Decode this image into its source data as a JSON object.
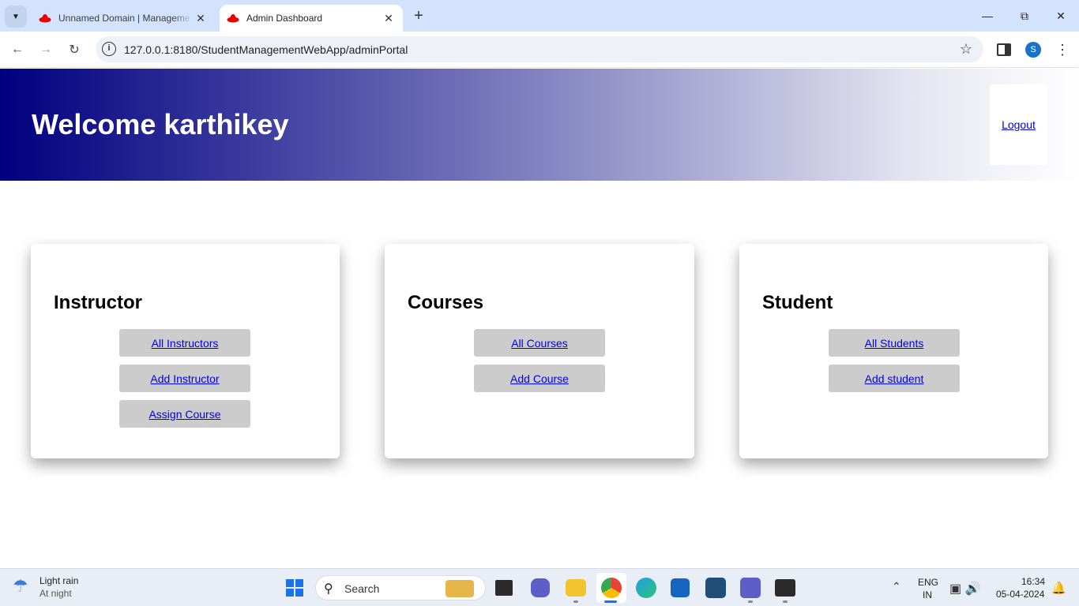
{
  "browser": {
    "tabs": [
      {
        "title": "Unnamed Domain | Manageme",
        "active": false
      },
      {
        "title": "Admin Dashboard",
        "active": true
      }
    ],
    "url": "127.0.0.1:8180/StudentManagementWebApp/adminPortal",
    "profile_initial": "S"
  },
  "header": {
    "welcome": "Welcome karthikey",
    "logout_label": "Logout"
  },
  "cards": [
    {
      "title": "Instructor",
      "links": [
        "All Instructors",
        "Add Instructor",
        "Assign Course"
      ]
    },
    {
      "title": "Courses",
      "links": [
        "All Courses",
        "Add Course"
      ]
    },
    {
      "title": "Student",
      "links": [
        "All Students",
        "Add student"
      ]
    }
  ],
  "taskbar": {
    "weather_condition": "Light rain",
    "weather_sub": "At night",
    "search_placeholder": "Search",
    "lang_line1": "ENG",
    "lang_line2": "IN",
    "time": "16:34",
    "date": "05-04-2024"
  },
  "colors": {
    "header_gradient_start": "#00007f",
    "link": "#0000ee",
    "button_bg": "#cccccc"
  }
}
